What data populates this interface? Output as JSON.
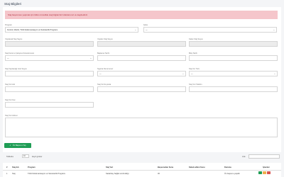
{
  "page": {
    "title": "Staj Bilgileri"
  },
  "alert": {
    "text": "Staj başvurusu yapmak için lütfen öncelikle staj bilgilerinizi doldurunuz ve kaydediniz."
  },
  "form": {
    "program": {
      "label": "Program",
      "value": "Kontrol, Metrik, Tıbbi Dokümantasyon ve Sekreterlik Programı"
    },
    "sube": {
      "label": "Şube",
      "value": "—"
    },
    "fields": {
      "f1": {
        "label": "Yapılacak Staj Sayısı"
      },
      "f2": {
        "label": "Yapılan Staj Sayısı"
      },
      "f3": {
        "label": "Kalan Staj Sayısı"
      },
      "f4": {
        "label": "Staj Kurumu Çalışma Kümelenmesi",
        "value": "—"
      },
      "f5": {
        "label": "Başlama Tarihi"
      },
      "f6": {
        "label": "Bitiş Tarihi"
      },
      "f7": {
        "label": "Staj Yapılacağı Gün Sayısı"
      },
      "f8": {
        "label": "Sigorta Durumunuz",
        "value": "—"
      },
      "f9": {
        "label": "Staj Yer Türü",
        "value": "—"
      },
      "f10": {
        "label": "Staj Yeri Adı"
      },
      "f11": {
        "label": "Staj Yeri E-posta"
      },
      "f12": {
        "label": "Staj Yeri Telefon"
      },
      "f13": {
        "label": "Staj Yeri Fax"
      },
      "f14": {
        "label": "Staj Yeri Adresi"
      }
    },
    "save_label": "Ön Başvuru Yap"
  },
  "table_tools": {
    "show": "Tabloda",
    "length": "10",
    "entries": "kayıt göster",
    "search": "Ara:"
  },
  "table": {
    "headers": [
      "#",
      "Staj Adı",
      "Program",
      "Staj Yeri",
      "Başvurudan Sonu",
      "Kabul edilen Sonu",
      "Durumu",
      "İşlemler"
    ],
    "row": [
      "1",
      "Staj",
      "Tıbbi Dokümantasyon ve Sekreterlik Programı",
      "Sadarbay Sağlık sınıfındılığı",
      "30",
      "",
      "Ön başvuru yapıldı"
    ]
  },
  "colors": {
    "accent": "#1f9d55",
    "alert_bg": "#f5c6cb",
    "alert_text": "#b0293a"
  }
}
